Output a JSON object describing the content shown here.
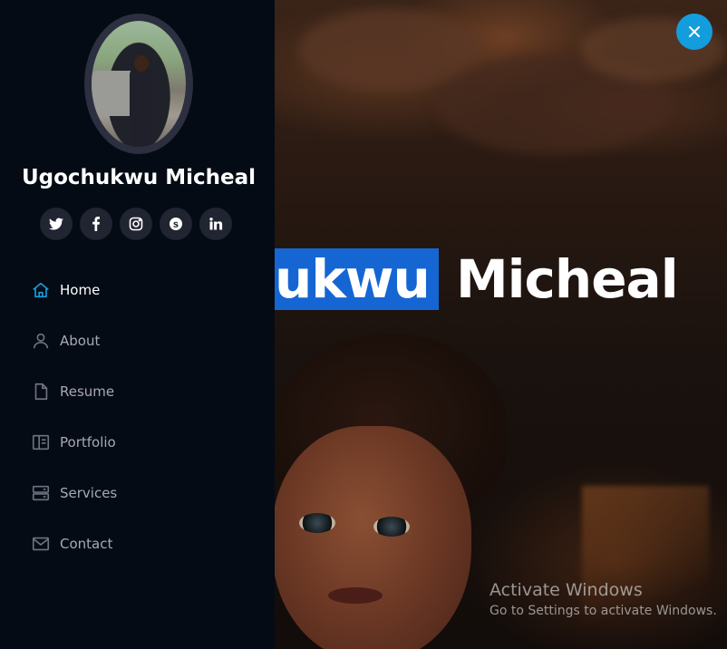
{
  "profile": {
    "name": "Ugochukwu Micheal"
  },
  "socials": [
    {
      "icon": "twitter-icon"
    },
    {
      "icon": "facebook-icon"
    },
    {
      "icon": "instagram-icon"
    },
    {
      "icon": "skype-icon"
    },
    {
      "icon": "linkedin-icon"
    }
  ],
  "nav": {
    "items": [
      {
        "label": "Home",
        "icon": "home-icon",
        "active": true
      },
      {
        "label": "About",
        "icon": "person-icon",
        "active": false
      },
      {
        "label": "Resume",
        "icon": "file-icon",
        "active": false
      },
      {
        "label": "Portfolio",
        "icon": "book-half-icon",
        "active": false
      },
      {
        "label": "Services",
        "icon": "server-icon",
        "active": false
      },
      {
        "label": "Contact",
        "icon": "envelope-icon",
        "active": false
      }
    ]
  },
  "hero": {
    "title_selected": "ukwu",
    "title_rest": " Micheal"
  },
  "watermark": {
    "title": "Activate Windows",
    "subtitle": "Go to Settings to activate Windows."
  },
  "colors": {
    "accent": "#149ddd",
    "sidebar_bg": "#040b14",
    "social_bg": "#212431",
    "selection": "#1566d3"
  }
}
